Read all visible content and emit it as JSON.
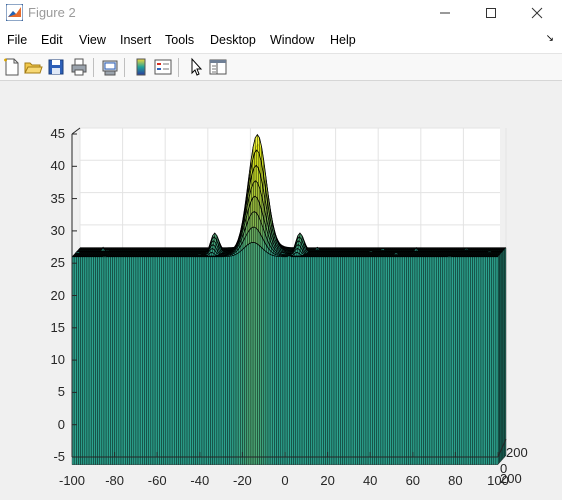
{
  "window": {
    "title": "Figure 2",
    "icon": "matlab-icon"
  },
  "menu": {
    "items": [
      "File",
      "Edit",
      "View",
      "Insert",
      "Tools",
      "Desktop",
      "Window",
      "Help"
    ],
    "dock_arrow": "↘"
  },
  "toolbar": {
    "buttons": [
      "new-figure-icon",
      "open-file-icon",
      "save-icon",
      "print-icon",
      "print-preview-icon",
      "colorbar-icon",
      "legend-icon",
      "edit-plot-cursor-icon",
      "property-inspector-icon"
    ]
  },
  "colors": {
    "surface_low": "#2a3a6e",
    "surface_mid": "#21a39a",
    "surface_high": "#f2d83a",
    "mesh_edge": "#000000"
  },
  "chart_data": {
    "type": "surface",
    "colormap": "parula",
    "grid": true,
    "x_ticks": [
      "-100",
      "-80",
      "-60",
      "-40",
      "-20",
      "0",
      "20",
      "40",
      "60",
      "80",
      "100"
    ],
    "y_ticks": [
      "-5",
      "0",
      "5",
      "10",
      "15",
      "20",
      "25",
      "30",
      "35",
      "40",
      "45"
    ],
    "depth_ticks": [
      "0",
      "200",
      "200"
    ],
    "xlim": [
      -100,
      100
    ],
    "zlim": [
      -5,
      45
    ],
    "noise_floor_range": [
      0,
      27
    ],
    "peak": {
      "x": -15,
      "value": 44.5,
      "width": 6
    },
    "side_lobes": [
      {
        "x": -35,
        "value": 29
      },
      {
        "x": 5,
        "value": 29
      }
    ]
  }
}
